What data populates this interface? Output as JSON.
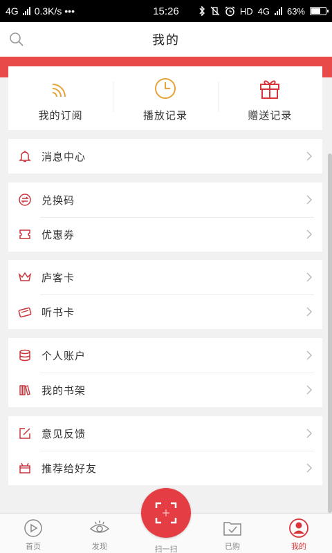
{
  "status_bar": {
    "network": "4G",
    "speed": "0.3K/s •••",
    "time": "15:26",
    "hd": "HD",
    "network_right": "4G",
    "battery": "63%"
  },
  "header": {
    "title": "我的"
  },
  "quick_actions": [
    {
      "label": "我的订阅",
      "icon": "rss-icon"
    },
    {
      "label": "播放记录",
      "icon": "clock-icon"
    },
    {
      "label": "赠送记录",
      "icon": "gift-icon"
    }
  ],
  "sections": [
    [
      {
        "label": "消息中心",
        "icon": "bell-icon"
      }
    ],
    [
      {
        "label": "兑换码",
        "icon": "exchange-icon"
      },
      {
        "label": "优惠券",
        "icon": "coupon-icon"
      }
    ],
    [
      {
        "label": "庐客卡",
        "icon": "crown-icon"
      },
      {
        "label": "听书卡",
        "icon": "card-icon"
      }
    ],
    [
      {
        "label": "个人账户",
        "icon": "coins-icon"
      },
      {
        "label": "我的书架",
        "icon": "bookshelf-icon"
      }
    ],
    [
      {
        "label": "意见反馈",
        "icon": "edit-icon"
      },
      {
        "label": "推荐给好友",
        "icon": "share-gift-icon"
      }
    ]
  ],
  "tabs": [
    {
      "label": "首页",
      "icon": "play-circle-icon"
    },
    {
      "label": "发现",
      "icon": "eye-icon"
    },
    {
      "label": "扫一扫",
      "icon": "scan-icon"
    },
    {
      "label": "已购",
      "icon": "folder-check-icon"
    },
    {
      "label": "我的",
      "icon": "user-circle-icon"
    }
  ],
  "colors": {
    "accent": "#e84a4a",
    "icon_orange": "#e7a23a",
    "icon_red": "#c9343a"
  }
}
